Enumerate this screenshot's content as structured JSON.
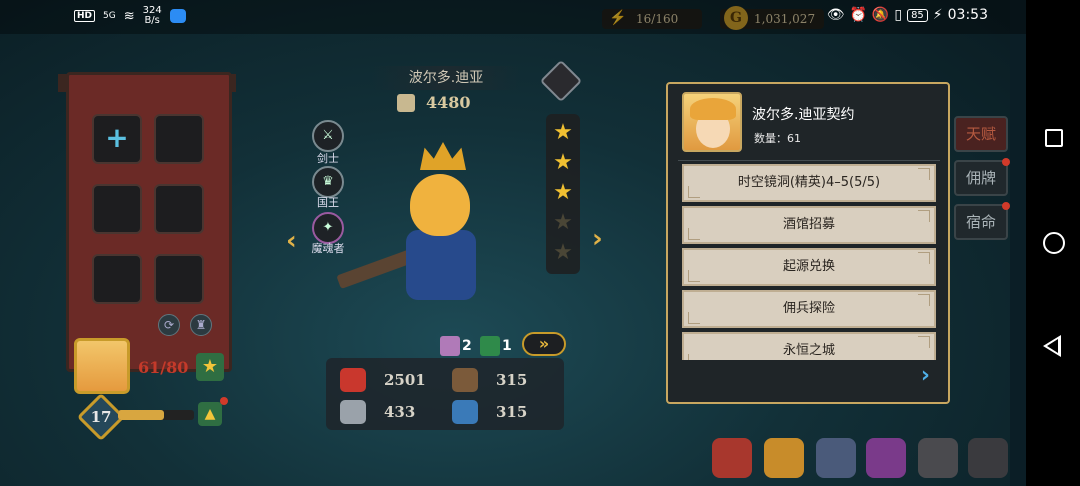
{
  "statusbar": {
    "net_speed": "324",
    "net_unit": "B/s",
    "signal": "5G",
    "hd": "HD",
    "battery": "85",
    "time": "03:53"
  },
  "resources": {
    "stamina": "16/160",
    "gold": "1,031,027"
  },
  "hero": {
    "name": "波尔多.迪亚",
    "power": "4480",
    "classes": [
      "剑士",
      "国王",
      "魔魂者"
    ],
    "stars_filled": 3,
    "stars_total": 5,
    "shards": "61/80",
    "level": "17",
    "level_progress": 0.6,
    "item_a_count": "2",
    "item_b_count": "1",
    "stats": {
      "hp": "2501",
      "armor": "315",
      "attack": "433",
      "magic_resist": "315"
    }
  },
  "right_tabs": [
    "天赋",
    "佣牌",
    "宿命"
  ],
  "popup": {
    "title": "波尔多.迪亚契约",
    "quantity_label": "数量：61",
    "sources": [
      "时空镜洞(精英)4–5(5/5)",
      "酒馆招募",
      "起源兑换",
      "佣兵探险",
      "永恒之城"
    ]
  },
  "colors": {
    "accent_gold": "#c8a760",
    "panel_red": "#6b2a26",
    "source_bg": "#d9cfbf",
    "next_arrow": "#4fb0e8"
  }
}
